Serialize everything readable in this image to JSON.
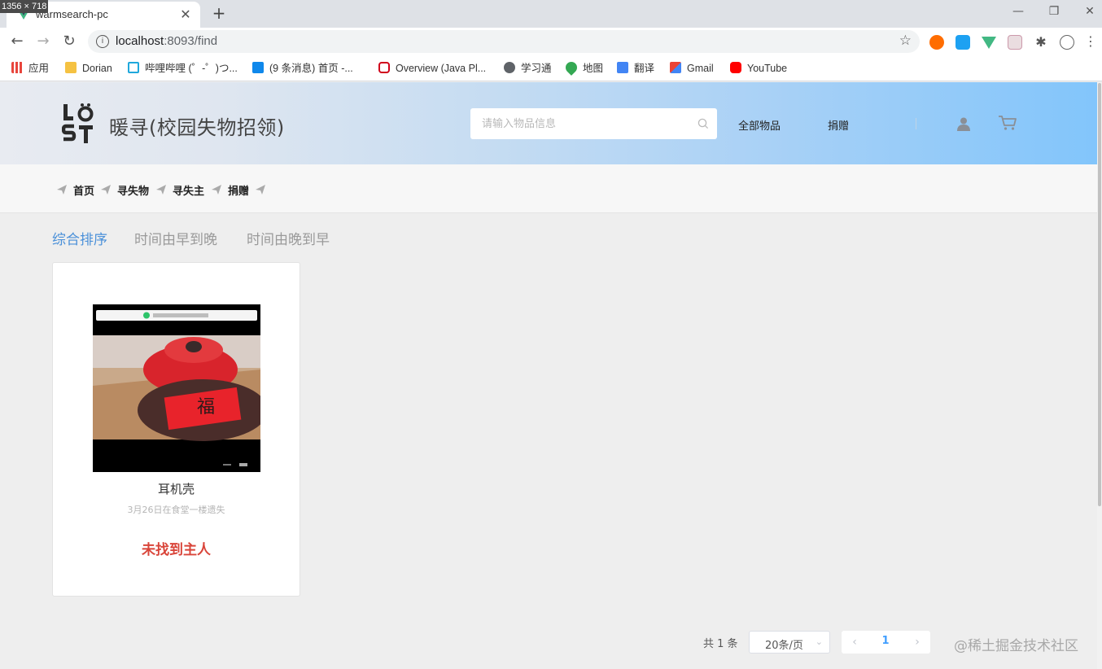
{
  "overlay": {
    "dimensions_label": "1356 × 718"
  },
  "browser": {
    "tab_title": "warmsearch-pc",
    "url_host": "localhost",
    "url_rest": ":8093/find",
    "new_tab_symbol": "+",
    "tab_close_symbol": "✕",
    "window_controls": [
      "—",
      "❐",
      "✕"
    ],
    "bookmarks": [
      {
        "label": "应用",
        "icon": "apps-grid-icon",
        "color": "#e8453c"
      },
      {
        "label": "Dorian",
        "icon": "folder-icon",
        "color": "#f5c242"
      },
      {
        "label": "哔哩哔哩 (゜-゜)つ...",
        "icon": "bilibili-icon",
        "color": "#20a8dc"
      },
      {
        "label": "(9 条消息) 首页 -...",
        "icon": "zhihu-icon",
        "color": "#0f88eb"
      },
      {
        "label": "Overview (Java Pl...",
        "icon": "oracle-icon",
        "color": "#d0021b"
      },
      {
        "label": "学习通",
        "icon": "globe-icon",
        "color": "#5f6368"
      },
      {
        "label": "地图",
        "icon": "maps-pin-icon",
        "color": "#34a853"
      },
      {
        "label": "翻译",
        "icon": "translate-icon",
        "color": "#4285f4"
      },
      {
        "label": "Gmail",
        "icon": "gmail-icon",
        "color": "#ea4335"
      },
      {
        "label": "YouTube",
        "icon": "youtube-icon",
        "color": "#ff0000"
      }
    ]
  },
  "site": {
    "title": "暖寻(校园失物招领)",
    "search_placeholder": "请输入物品信息",
    "nav": {
      "all_items": "全部物品",
      "donate": "捐赠"
    },
    "breadcrumbs": [
      "首页",
      "寻失物",
      "寻失主",
      "捐赠"
    ],
    "sort_options": [
      {
        "label": "综合排序",
        "active": true
      },
      {
        "label": "时间由早到晚",
        "active": false
      },
      {
        "label": "时间由晚到早",
        "active": false
      }
    ],
    "accent_color": "#4a90d9",
    "status_color": "#d9453a"
  },
  "items": [
    {
      "name": "耳机壳",
      "description": "3月26日在食堂一楼遗失",
      "status": "未找到主人"
    }
  ],
  "pagination": {
    "total_text": "共 1 条",
    "page_size": "20条/页",
    "current_page": "1"
  },
  "watermark": "@稀土掘金技术社区"
}
